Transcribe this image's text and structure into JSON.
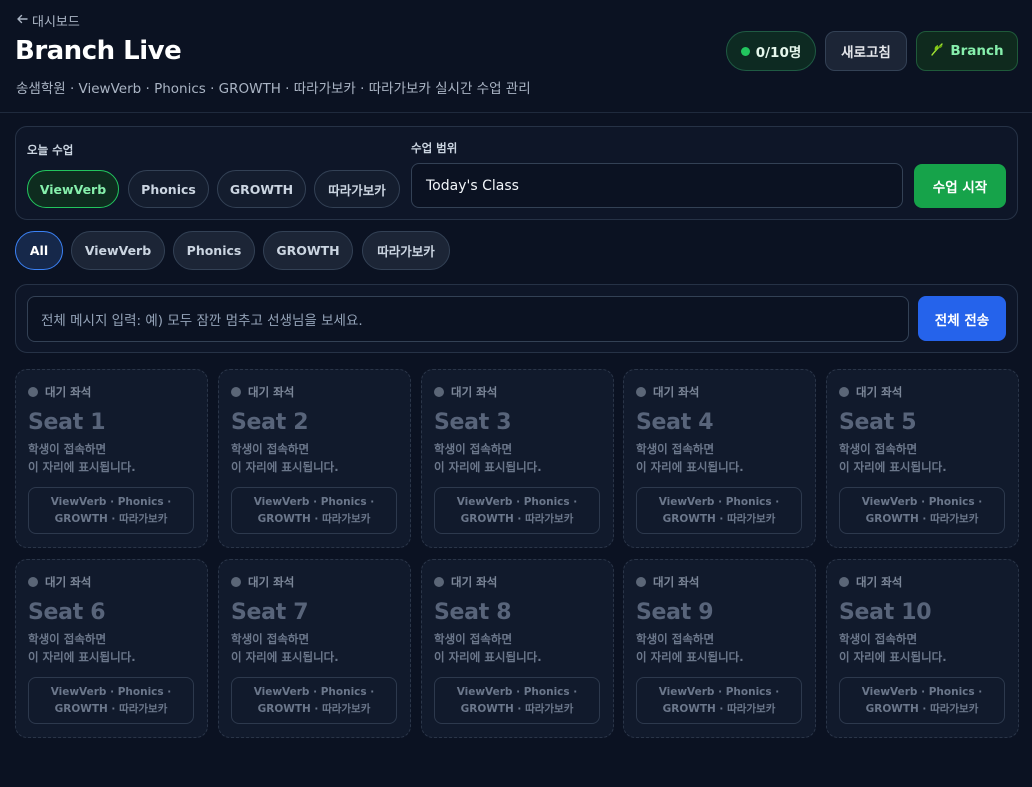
{
  "header": {
    "back_label": "대시보드",
    "title": "Branch Live",
    "subtitle": "송샘학원 · ViewVerb · Phonics · GROWTH · 따라가보카 · 따라가보카 실시간 수업 관리",
    "online_count": "0/10명",
    "refresh_label": "새로고침",
    "branch_label": "Branch",
    "colors": {
      "online": "#22c55e",
      "accent_green": "#16a34a",
      "accent_blue": "#2563eb"
    }
  },
  "class_panel": {
    "today_label": "오늘 수업",
    "classes": [
      "ViewVerb",
      "Phonics",
      "GROWTH",
      "따라가보카"
    ],
    "selected_class": "ViewVerb",
    "range_label": "수업 범위",
    "range_value": "Today's Class",
    "start_label": "수업 시작"
  },
  "filters": {
    "items": [
      "All",
      "ViewVerb",
      "Phonics",
      "GROWTH",
      "따라가보카"
    ],
    "selected": "All"
  },
  "broadcast": {
    "placeholder": "전체 메시지 입력: 예) 모두 잠깐 멈추고 선생님을 보세요.",
    "send_label": "전체 전송"
  },
  "seats": [
    {
      "status": "대기 좌석",
      "name": "Seat 1",
      "msg1": "학생이 접속하면",
      "msg2": "이 자리에 표시됩니다.",
      "tags1": "ViewVerb · Phonics ·",
      "tags2": "GROWTH · 따라가보카"
    },
    {
      "status": "대기 좌석",
      "name": "Seat 2",
      "msg1": "학생이 접속하면",
      "msg2": "이 자리에 표시됩니다.",
      "tags1": "ViewVerb · Phonics ·",
      "tags2": "GROWTH · 따라가보카"
    },
    {
      "status": "대기 좌석",
      "name": "Seat 3",
      "msg1": "학생이 접속하면",
      "msg2": "이 자리에 표시됩니다.",
      "tags1": "ViewVerb · Phonics ·",
      "tags2": "GROWTH · 따라가보카"
    },
    {
      "status": "대기 좌석",
      "name": "Seat 4",
      "msg1": "학생이 접속하면",
      "msg2": "이 자리에 표시됩니다.",
      "tags1": "ViewVerb · Phonics ·",
      "tags2": "GROWTH · 따라가보카"
    },
    {
      "status": "대기 좌석",
      "name": "Seat 5",
      "msg1": "학생이 접속하면",
      "msg2": "이 자리에 표시됩니다.",
      "tags1": "ViewVerb · Phonics ·",
      "tags2": "GROWTH · 따라가보카"
    },
    {
      "status": "대기 좌석",
      "name": "Seat 6",
      "msg1": "학생이 접속하면",
      "msg2": "이 자리에 표시됩니다.",
      "tags1": "ViewVerb · Phonics ·",
      "tags2": "GROWTH · 따라가보카"
    },
    {
      "status": "대기 좌석",
      "name": "Seat 7",
      "msg1": "학생이 접속하면",
      "msg2": "이 자리에 표시됩니다.",
      "tags1": "ViewVerb · Phonics ·",
      "tags2": "GROWTH · 따라가보카"
    },
    {
      "status": "대기 좌석",
      "name": "Seat 8",
      "msg1": "학생이 접속하면",
      "msg2": "이 자리에 표시됩니다.",
      "tags1": "ViewVerb · Phonics ·",
      "tags2": "GROWTH · 따라가보카"
    },
    {
      "status": "대기 좌석",
      "name": "Seat 9",
      "msg1": "학생이 접속하면",
      "msg2": "이 자리에 표시됩니다.",
      "tags1": "ViewVerb · Phonics ·",
      "tags2": "GROWTH · 따라가보카"
    },
    {
      "status": "대기 좌석",
      "name": "Seat 10",
      "msg1": "학생이 접속하면",
      "msg2": "이 자리에 표시됩니다.",
      "tags1": "ViewVerb · Phonics ·",
      "tags2": "GROWTH · 따라가보카"
    }
  ]
}
